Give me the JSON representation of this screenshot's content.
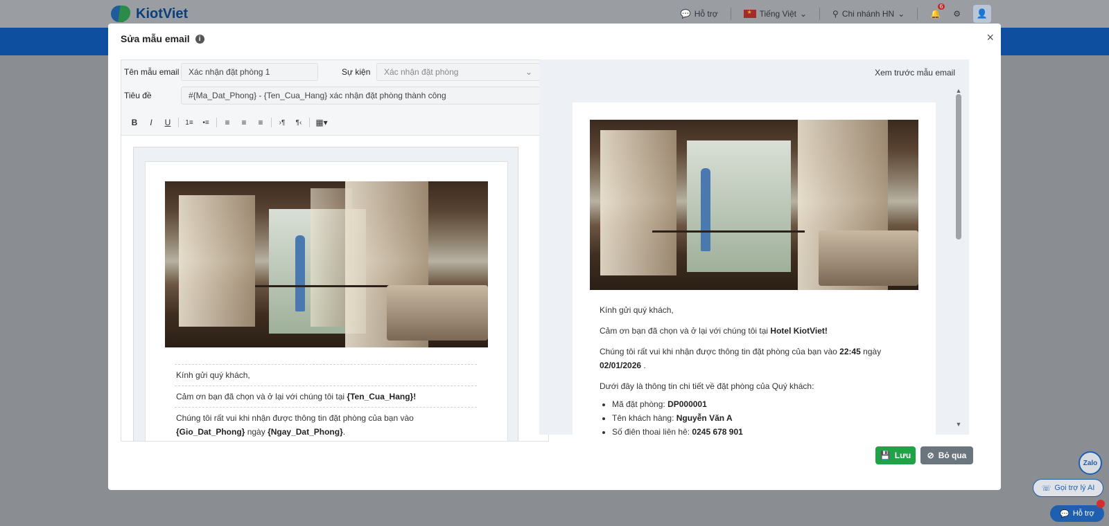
{
  "app": {
    "logo_text": "KiotViet",
    "nav": {
      "support": "Hỗ trợ",
      "language": "Tiếng Việt",
      "branch": "Chi nhánh HN",
      "notification_count": "6"
    }
  },
  "modal": {
    "title": "Sửa mẫu email",
    "form": {
      "template_name_label": "Tên mẫu email",
      "template_name_value": "Xác nhận đặt phòng 1",
      "event_label": "Sự kiện",
      "event_value": "Xác nhận đặt phòng",
      "subject_label": "Tiêu đề",
      "subject_value": "#{Ma_Dat_Phong} - {Ten_Cua_Hang} xác nhận đặt phòng thành công"
    },
    "toolbar": [
      "B",
      "I",
      "U",
      "1≡",
      "•≡",
      "≡",
      "≡",
      "≡",
      "›¶",
      "¶‹",
      "▦▾"
    ],
    "editor": {
      "greeting": "Kính gửi quý khách,",
      "thanks_prefix": "Cảm ơn bạn đã chọn và ở lại với chúng tôi tại ",
      "thanks_var": "{Ten_Cua_Hang}",
      "thanks_suffix": "!",
      "info_prefix": "Chúng tôi rất vui khi nhận được thông tin đặt phòng của bạn vào ",
      "info_time_var": "{Gio_Dat_Phong}",
      "info_mid": "ngày ",
      "info_date_var": "{Ngay_Dat_Phong}",
      "info_suffix": "."
    },
    "preview": {
      "label": "Xem trước mẫu email",
      "greeting": "Kính gửi quý khách,",
      "thanks_prefix": "Cảm ơn bạn đã chọn và ở lại với chúng tôi tại ",
      "thanks_name": "Hotel KiotViet!",
      "info_prefix": "Chúng tôi rất vui khi nhận được thông tin đặt phòng của bạn vào ",
      "info_time": "22:45",
      "info_mid": " ngày",
      "info_date": "02/01/2026",
      "info_suffix": " .",
      "details_intro": "Dưới đây là thông tin chi tiết về đặt phòng của Quý khách:",
      "items": [
        {
          "label": "Mã đặt phòng: ",
          "value": "DP000001"
        },
        {
          "label": "Tên khách hàng: ",
          "value": "Nguyễn Văn A"
        },
        {
          "label": "Số điện thoại liên hệ: ",
          "value": "0245 678 901"
        }
      ]
    },
    "buttons": {
      "save": "Lưu",
      "skip": "Bỏ qua"
    }
  },
  "floating": {
    "zalo": "Zalo",
    "ai": "Gọi trợ lý AI",
    "support": "Hỗ trợ"
  },
  "colors": {
    "brand_blue": "#0f4fa0",
    "save_green": "#1ea446",
    "skip_gray": "#6b757e"
  }
}
